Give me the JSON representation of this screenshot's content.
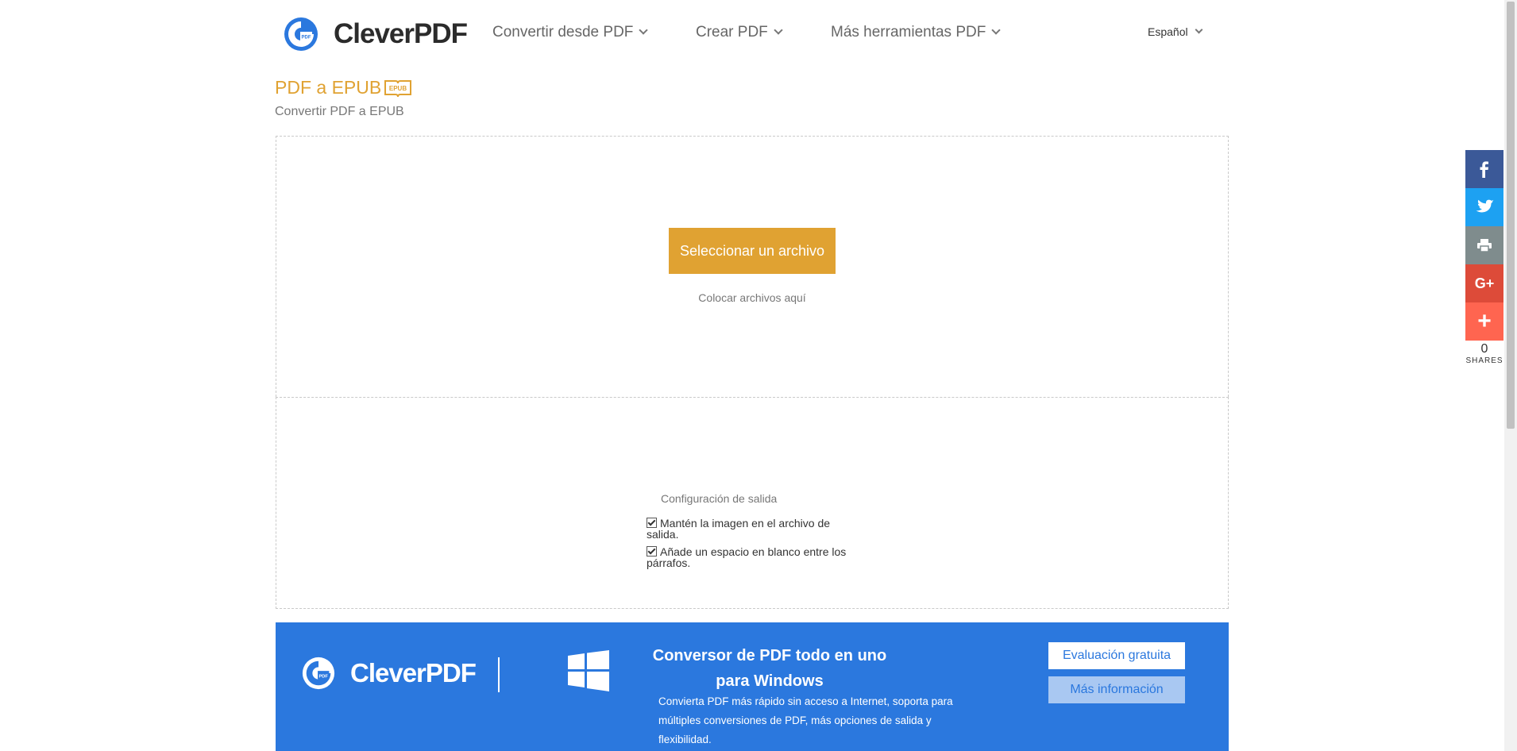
{
  "brand": {
    "name": "CleverPDF",
    "mark_text": "PDF"
  },
  "nav": {
    "items": [
      {
        "label": "Convertir desde PDF"
      },
      {
        "label": "Crear PDF"
      },
      {
        "label": "Más herramientas PDF"
      }
    ],
    "language": "Español"
  },
  "page": {
    "title": "PDF a EPUB",
    "badge": "EPUB",
    "subtitle": "Convertir PDF a EPUB"
  },
  "upload": {
    "button_label": "Seleccionar un archivo",
    "drop_hint": "Colocar archivos aquí"
  },
  "settings": {
    "title": "Configuración de salida",
    "options": [
      {
        "label": "Mantén la imagen en el archivo de salida.",
        "checked": true
      },
      {
        "label": "Añade un espacio en blanco entre los párrafos.",
        "checked": true
      }
    ]
  },
  "banner": {
    "title": "Conversor de PDF todo en uno para Windows",
    "description": "Convierta PDF más rápido sin acceso a Internet, soporta para múltiples conversiones de PDF, más opciones de salida y flexibilidad.",
    "trial_button": "Evaluación gratuita",
    "more_button": "Más información"
  },
  "share": {
    "count": "0",
    "label": "SHARES",
    "buttons": [
      {
        "icon": "facebook-icon",
        "color": "#3b5998"
      },
      {
        "icon": "twitter-icon",
        "color": "#1da1f2"
      },
      {
        "icon": "print-icon",
        "color": "#7f8c8d"
      },
      {
        "icon": "google-plus-icon",
        "color": "#dd4b39"
      },
      {
        "icon": "plus-icon",
        "color": "#ff6550"
      }
    ]
  },
  "colors": {
    "accent": "#e0a232",
    "brand_blue": "#2b78de",
    "button_secondary": "#a9c8f2"
  }
}
